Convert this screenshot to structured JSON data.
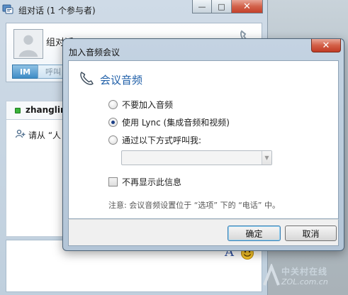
{
  "chat_window": {
    "title": "组对话 (1 个参与者)",
    "group_name": "组对话",
    "tabs": [
      {
        "label": "IM",
        "active": true
      },
      {
        "label": "呼叫",
        "active": false
      }
    ],
    "participant": "zhanglinli",
    "hint_text": "请从 “人",
    "caption_buttons": {
      "minimize": "—",
      "maximize": "□",
      "close": "✕"
    },
    "compose_font_icon": "A"
  },
  "dialog": {
    "title": "加入音频会议",
    "close_glyph": "✕",
    "section_title": "会议音频",
    "options": [
      {
        "label": "不要加入音频",
        "selected": false
      },
      {
        "label": "使用 Lync (集成音频和视频)",
        "selected": true
      },
      {
        "label": "通过以下方式呼叫我:",
        "selected": false
      }
    ],
    "dial_value": "",
    "dont_show_label": "不再显示此信息",
    "dont_show_checked": false,
    "note": "注意: 会议音频设置位于 “选项” 下的 “电话” 中。",
    "ok_label": "确定",
    "cancel_label": "取消"
  },
  "watermark": {
    "line1": "中关村在线",
    "line2": "ZOL.com.cn"
  },
  "colors": {
    "accent": "#1f5fa8",
    "tab_active": "#3e8cc6",
    "presence": "#3bb43b",
    "close_red": "#c13b25"
  }
}
